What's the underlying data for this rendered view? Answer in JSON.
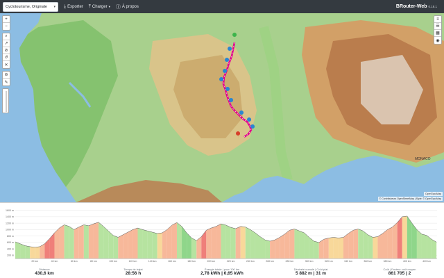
{
  "navbar": {
    "profile_value": "Cyclotourisme, Originale",
    "export_label": "Exporter",
    "load_label": "Charger",
    "about_label": "À propos",
    "brand": "BRouter-Web",
    "version": "0.18.1"
  },
  "map": {
    "attribution": "© Contributeurs OpenStreetMap | Style: © OpenTopoMap",
    "coords": "OpenTopoMap",
    "labels": {
      "monaco": "MONACO"
    },
    "colors": {
      "route": "#e0008a",
      "marker": "#2a86d1",
      "start_marker": "#3cb44b",
      "end_marker": "#d63e2a"
    }
  },
  "elevation": {
    "y_ticks": [
      "1600 m",
      "1400 m",
      "1200 m",
      "1000 m",
      "800 m",
      "600 m",
      "400 m",
      "200 m"
    ],
    "x_ticks": [
      "20 km",
      "40 km",
      "60 km",
      "80 km",
      "100 km",
      "120 km",
      "140 km",
      "160 km",
      "180 km",
      "200 km",
      "220 km",
      "240 km",
      "260 km",
      "280 km",
      "300 km",
      "320 km",
      "340 km",
      "360 km",
      "380 km",
      "400 km",
      "420 km"
    ],
    "x_ticks_unit": "km",
    "profile": [
      [
        0,
        620
      ],
      [
        5,
        560
      ],
      [
        10,
        500
      ],
      [
        15,
        470
      ],
      [
        20,
        450
      ],
      [
        25,
        470
      ],
      [
        30,
        560
      ],
      [
        35,
        720
      ],
      [
        40,
        900
      ],
      [
        45,
        1050
      ],
      [
        50,
        1150
      ],
      [
        55,
        1100
      ],
      [
        60,
        1000
      ],
      [
        65,
        1080
      ],
      [
        70,
        1150
      ],
      [
        75,
        1120
      ],
      [
        80,
        1180
      ],
      [
        85,
        1230
      ],
      [
        90,
        1100
      ],
      [
        95,
        960
      ],
      [
        100,
        820
      ],
      [
        105,
        760
      ],
      [
        110,
        840
      ],
      [
        115,
        920
      ],
      [
        120,
        1000
      ],
      [
        125,
        1050
      ],
      [
        130,
        1000
      ],
      [
        135,
        960
      ],
      [
        140,
        920
      ],
      [
        145,
        880
      ],
      [
        150,
        900
      ],
      [
        155,
        1000
      ],
      [
        160,
        1140
      ],
      [
        165,
        1220
      ],
      [
        170,
        1100
      ],
      [
        175,
        900
      ],
      [
        180,
        740
      ],
      [
        185,
        660
      ],
      [
        190,
        780
      ],
      [
        195,
        980
      ],
      [
        200,
        1050
      ],
      [
        205,
        1100
      ],
      [
        210,
        1180
      ],
      [
        215,
        1140
      ],
      [
        220,
        1070
      ],
      [
        225,
        1030
      ],
      [
        230,
        1100
      ],
      [
        235,
        1080
      ],
      [
        240,
        1000
      ],
      [
        245,
        900
      ],
      [
        250,
        780
      ],
      [
        255,
        680
      ],
      [
        260,
        640
      ],
      [
        265,
        680
      ],
      [
        270,
        760
      ],
      [
        275,
        860
      ],
      [
        280,
        980
      ],
      [
        285,
        1020
      ],
      [
        290,
        960
      ],
      [
        295,
        900
      ],
      [
        300,
        760
      ],
      [
        305,
        640
      ],
      [
        310,
        600
      ],
      [
        315,
        700
      ],
      [
        320,
        740
      ],
      [
        325,
        760
      ],
      [
        330,
        740
      ],
      [
        335,
        760
      ],
      [
        340,
        880
      ],
      [
        345,
        980
      ],
      [
        350,
        1020
      ],
      [
        355,
        960
      ],
      [
        360,
        840
      ],
      [
        365,
        760
      ],
      [
        370,
        780
      ],
      [
        375,
        880
      ],
      [
        380,
        1000
      ],
      [
        385,
        1080
      ],
      [
        390,
        1220
      ],
      [
        395,
        1400
      ],
      [
        400,
        1420
      ],
      [
        405,
        1200
      ],
      [
        410,
        1000
      ],
      [
        415,
        860
      ],
      [
        420,
        820
      ],
      [
        425,
        700
      ],
      [
        430,
        610
      ]
    ]
  },
  "stats": [
    {
      "label": "Distance",
      "value": "430,6 km"
    },
    {
      "label": "Temps de trajet",
      "value": "28:56 h"
    },
    {
      "label": "Énergie totale | pour 100 km",
      "value": "2,78 kWh | 0,65 kWh"
    },
    {
      "label": "Dénivelé cumulé | Coût plat",
      "value": "5 882 m | 31 m"
    },
    {
      "label": "Coût | Facteur coût moyen",
      "value": "861 705 | 2"
    }
  ],
  "toolbar_left_icons": [
    "zoom-in-icon",
    "zoom-out-icon",
    "search-icon",
    "draw-route-icon",
    "stop-icon",
    "delete-last-icon",
    "delete-route-icon",
    "nogo-icon",
    "pencil-icon",
    "fullscreen-icon"
  ],
  "toolbar_right_icons": [
    "layers-icon",
    "list-icon",
    "locate-icon",
    "route-details-icon"
  ]
}
